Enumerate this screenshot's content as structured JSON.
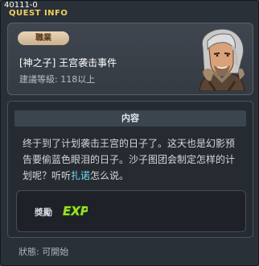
{
  "window": {
    "quest_id": "40111-0",
    "title": "QUEST INFO",
    "close_icon": "close-icon"
  },
  "header": {
    "job_badge": "職業",
    "quest_name": "[神之子] 王宫袭击事件",
    "level_requirement": "建議等級: 118以上"
  },
  "content": {
    "section_title": "内容",
    "description_before": "终于到了计划袭击王宫的日子了。这天也是幻影预告要偷蓝色眼泪的日子。沙子图团会制定怎样的计划呢？听听",
    "npc_name": "扎诺",
    "description_after": "怎么说。",
    "reward_label": "獎勵",
    "reward_icon_text": "EXP"
  },
  "status": {
    "text": "狀態: 可開始"
  },
  "colors": {
    "title_yellow": "#f0d060",
    "npc_highlight": "#6ee0f0",
    "exp_green": "#9be22c"
  }
}
